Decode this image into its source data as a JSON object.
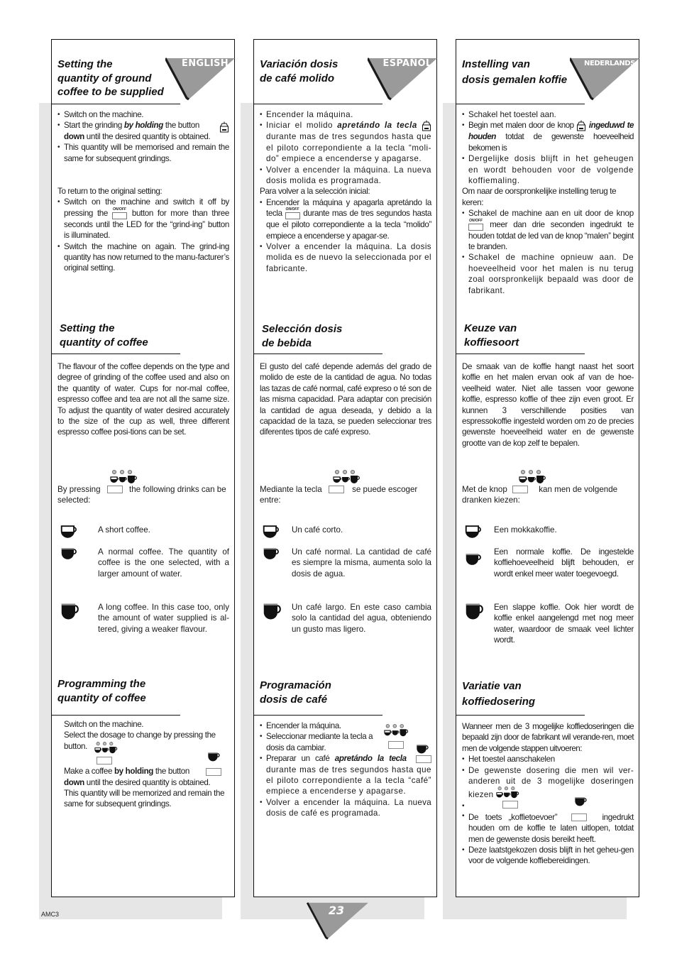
{
  "page": {
    "footer_code": "AMC3",
    "page_number": "23"
  },
  "columns": {
    "en": {
      "language": "ENGLISH",
      "s1": {
        "title": [
          "Setting the",
          "quantity of ground",
          "coffee to be supplied"
        ],
        "b1": "Switch on the machine.",
        "b2_pre": "Start the grinding ",
        "b2_em": "by holding",
        "b2_mid": " the button ",
        "b2_strong": "down",
        "b2_post": " until the desired quantity is obtained.",
        "b3": "This quantity will be memorised and remain the same for subsequent grindings.",
        "reset_intro": "To return to the original setting:",
        "r1_pre": "Switch on the machine and switch it off by pressing the ",
        "r1_post": " button for more than three seconds until the LED for the “grind-ing” button is illuminated.",
        "r2": "Switch the machine on again.  The grind-ing quantity has now returned to the manu-facturer’s original setting."
      },
      "s2": {
        "title": [
          "Setting the",
          "quantity of coffee"
        ],
        "body": "The flavour of the coffee depends on the type and degree of grinding of the coffee used and also on the quantity of water.  Cups for nor-mal coffee, espresso coffee and tea are not all the same size.  To adjust the quantity of water desired accurately to the size of the cup as well, three different espresso coffee posi-tions can be set.",
        "select_pre": "By pressing ",
        "select_post": " the following drinks can be selected:",
        "drinks": [
          "A short coffee.",
          "A normal coffee.  The quantity of coffee is the one selected, with a larger amount of water.",
          "A long coffee.  In this case too, only the amount of water supplied is al-tered, giving a weaker flavour."
        ]
      },
      "s3": {
        "title": [
          "Programming the",
          "quantity of coffee"
        ],
        "l1": "Switch on the machine.",
        "l2": "Select the dosage to change by pressing the button.",
        "l3_pre": "Make a coffee ",
        "l3_strong": "by holding",
        "l3_mid": " the button ",
        "l3_strong2": "down",
        "l3_post": " until the desired quantity is obtained.",
        "l4": "This quantity will be memorized and remain the same for subsequent grindings."
      }
    },
    "es": {
      "language": "ESPAÑOL",
      "s1": {
        "title": [
          "Variación dosis",
          "de café molido"
        ],
        "b1": "Encender la máquina.",
        "b2_pre": "Iniciar el molido ",
        "b2_em": "apretándo la tecla",
        "b2_post": " durante mas de tres segundos hasta que el piloto correpondiente a la tecla “moli-do” empiece a encenderse y apagarse.",
        "b3": "Volver a encender la máquina. La nueva dosis molida es programada.",
        "reset_intro": "Para volver a la selección inicial:",
        "r1_pre": "Encender la máquina y apagarla apretándo la tecla ",
        "r1_post": " durante mas de tres segundos hasta que el piloto correpondiente a la tecla “molido” empiece a encenderse y apagar-se.",
        "r2": "Volver a encender la máquina. La dosis molida es de nuevo la seleccionada por el fabricante."
      },
      "s2": {
        "title": [
          "Selección dosis",
          "de bebida"
        ],
        "body": "El gusto del café depende además del grado de molido de este de la cantidad de agua. No todas las tazas de café normal, café expreso o té son de las misma capacidad. Para adaptar con precisión la cantidad de agua deseada, y debido a la capacidad de la taza, se pueden seleccionar tres diferentes tipos de café expreso.",
        "select_pre": "Mediante la tecla ",
        "select_post": " se puede escoger entre:",
        "drinks": [
          "Un café corto.",
          "Un café normal. La cantidad de café es siempre la misma, aumenta solo la dosis de agua.",
          "Un café largo. En este caso cambia solo la cantidad del agua, obteniendo un gusto mas ligero."
        ]
      },
      "s3": {
        "title": [
          "Programación",
          "dosis de café"
        ],
        "b1": "Encender la máquina.",
        "b2": "Seleccionar mediante la tecla a dosis da cambiar.",
        "b3_pre": "Preparar un café ",
        "b3_em": "apretándo la tecla",
        "b3_post": " durante mas de tres segundos hasta que el piloto correpondiente a la tecla “café” empiece a encenderse y apagarse.",
        "b4": "Volver a encender la máquina. La nueva dosis de café  es programada."
      }
    },
    "nl": {
      "language": "NEDERLANDS",
      "s1": {
        "title": [
          "Instelling van",
          "dosis gemalen koffie"
        ],
        "b1": "Schakel het toestel aan.",
        "b2_pre": "Begin met malen door de knop ",
        "b2_em": "ingeduwd te houden",
        "b2_post": " totdat de gewenste hoeveelheid bekomen is",
        "b3": "Dergelijke dosis blijft in het geheugen en wordt behouden voor de volgende koffiemaling.",
        "reset_intro": "Om naar de oorspronkelijke instelling terug te keren:",
        "r1_pre": "Schakel de machine aan en uit door de knop ",
        "r1_post": " meer dan drie seconden ingedrukt te houden totdat  de led van de knop “malen” begint te branden.",
        "r2": "Schakel de machine opnieuw aan. De hoeveelheid voor het malen is nu terug zoal oorspronkelijk bepaald was door de fabrikant."
      },
      "s2": {
        "title": [
          "Keuze van",
          "koffiesoort"
        ],
        "body": "De smaak van de koffie hangt naast het soort koffie en het malen ervan ook af van de hoe-veelheid water. Niet alle tassen voor gewone koffie, espresso koffie of thee zijn even groot. Er kunnen 3 verschillende posities van espressokoffie ingesteld worden om zo de precies gewenste hoeveelheid water en de gewenste grootte van de kop zelf te bepalen.",
        "select_pre": "Met de knop ",
        "select_post": " kan men de volgende dranken kiezen:",
        "drinks": [
          "Een mokkakoffie.",
          "Een normale koffie. De ingestelde koffiehoeveelheid blijft behouden, er wordt enkel meer water toegevoegd.",
          "Een slappe koffie. Ook hier wordt de koffie enkel aangelengd met nog meer water, waardoor de smaak veel lichter wordt."
        ]
      },
      "s3": {
        "title": [
          "Variatie van",
          "koffiedosering"
        ],
        "intro": "Wanneer men de 3 mogelijke koffiedoseringen die bepaald zijn door de fabrikant wil verande-ren, moet men de volgende stappen uitvoeren:",
        "b1": "Het toestel aanschakelen",
        "b2": "De gewenste dosering die men wil ver-anderen uit de 3 mogelijke doseringen kiezen",
        "b3_pre": "De toets „koffietoevoer” ",
        "b3_post": " ingedrukt houden om de koffie te laten uitlopen, totdat men de gewenste dosis bereikt heeft.",
        "b4": "Deze laatstgekozen dosis blijft in het geheu-gen voor de volgende koffiebereidingen."
      }
    }
  },
  "icons": {
    "grinder": "grinder-button-icon",
    "onoff": "on-off-button-icon",
    "cups": "cup-size-selector-icon",
    "coffee": "coffee-dispense-icon",
    "key": "button-key-icon"
  }
}
